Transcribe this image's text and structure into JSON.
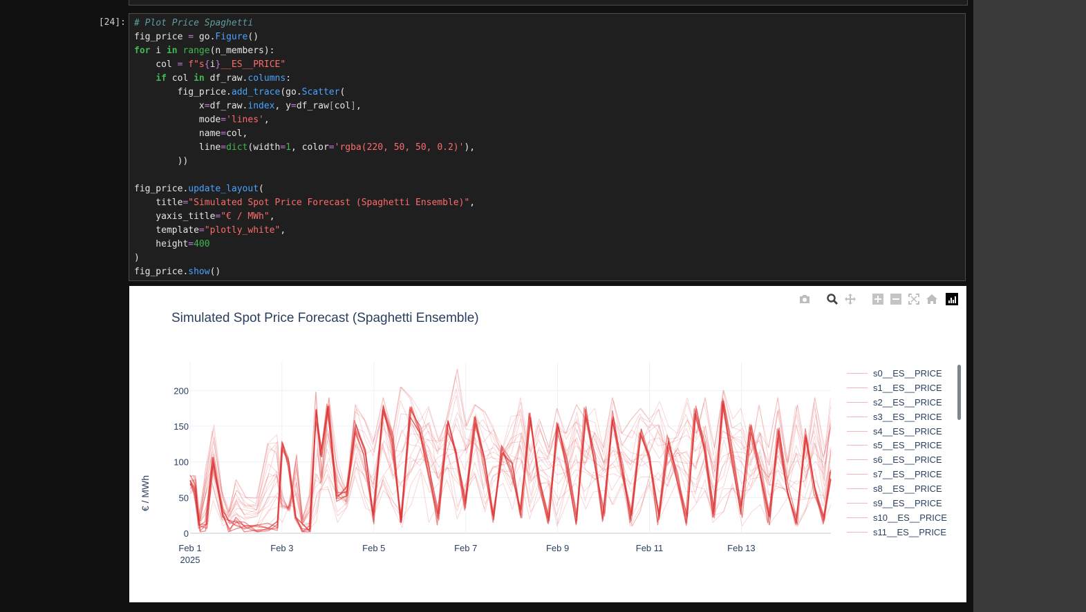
{
  "cell": {
    "prompt": "[24]:",
    "code_lines": [
      [
        [
          "# Plot Price Spaghetti",
          "comment"
        ]
      ],
      [
        [
          "fig_price ",
          ""
        ],
        [
          "=",
          "op"
        ],
        [
          " go.",
          ""
        ],
        [
          "Figure",
          "attr"
        ],
        [
          "()",
          ""
        ]
      ],
      [
        [
          "for",
          "kw"
        ],
        [
          " i ",
          ""
        ],
        [
          "in",
          "kw"
        ],
        [
          " ",
          ""
        ],
        [
          "range",
          "bi"
        ],
        [
          "(n_members):",
          ""
        ]
      ],
      [
        [
          "    col ",
          ""
        ],
        [
          "=",
          "op"
        ],
        [
          " ",
          ""
        ],
        [
          "f\"s",
          "str"
        ],
        [
          "{",
          "op"
        ],
        [
          "i",
          ""
        ],
        [
          "}",
          "op"
        ],
        [
          "__ES__PRICE\"",
          "str"
        ]
      ],
      [
        [
          "    ",
          ""
        ],
        [
          "if",
          "kw"
        ],
        [
          " col ",
          ""
        ],
        [
          "in",
          "kw"
        ],
        [
          " df_raw.",
          ""
        ],
        [
          "columns",
          "attr"
        ],
        [
          ":",
          ""
        ]
      ],
      [
        [
          "        fig_price.",
          ""
        ],
        [
          "add_trace",
          "attr"
        ],
        [
          "(go.",
          ""
        ],
        [
          "Scatter",
          "attr"
        ],
        [
          "(",
          ""
        ]
      ],
      [
        [
          "            x",
          ""
        ],
        [
          "=",
          "op"
        ],
        [
          "df_raw.",
          ""
        ],
        [
          "index",
          "attr"
        ],
        [
          ", y",
          ""
        ],
        [
          "=",
          "op"
        ],
        [
          "df_raw",
          ""
        ],
        [
          "[",
          "brk"
        ],
        [
          "col",
          ""
        ],
        [
          "]",
          "brk"
        ],
        [
          ",",
          ""
        ]
      ],
      [
        [
          "            mode",
          ""
        ],
        [
          "=",
          "op"
        ],
        [
          "'lines'",
          "str"
        ],
        [
          ",",
          ""
        ]
      ],
      [
        [
          "            name",
          ""
        ],
        [
          "=",
          "op"
        ],
        [
          "col,",
          ""
        ]
      ],
      [
        [
          "            line",
          ""
        ],
        [
          "=",
          "op"
        ],
        [
          "dict",
          "bi"
        ],
        [
          "(width",
          ""
        ],
        [
          "=",
          "op"
        ],
        [
          "1",
          "num"
        ],
        [
          ", color",
          ""
        ],
        [
          "=",
          "op"
        ],
        [
          "'rgba(220, 50, 50, 0.2)'",
          "str"
        ],
        [
          "),",
          ""
        ]
      ],
      [
        [
          "        ))",
          ""
        ]
      ],
      [],
      [
        [
          "fig_price.",
          ""
        ],
        [
          "update_layout",
          "attr"
        ],
        [
          "(",
          ""
        ]
      ],
      [
        [
          "    title",
          ""
        ],
        [
          "=",
          "op"
        ],
        [
          "\"Simulated Spot Price Forecast (Spaghetti Ensemble)\"",
          "str"
        ],
        [
          ",",
          ""
        ]
      ],
      [
        [
          "    yaxis_title",
          ""
        ],
        [
          "=",
          "op"
        ],
        [
          "\"€ / MWh\"",
          "str"
        ],
        [
          ",",
          ""
        ]
      ],
      [
        [
          "    template",
          ""
        ],
        [
          "=",
          "op"
        ],
        [
          "\"plotly_white\"",
          "str"
        ],
        [
          ",",
          ""
        ]
      ],
      [
        [
          "    height",
          ""
        ],
        [
          "=",
          "op"
        ],
        [
          "400",
          "num"
        ]
      ],
      [
        [
          ")",
          ""
        ]
      ],
      [
        [
          "fig_price.",
          ""
        ],
        [
          "show",
          "attr"
        ],
        [
          "()",
          ""
        ]
      ]
    ]
  },
  "modebar": {
    "icons": [
      "camera-icon",
      "zoom-icon",
      "pan-icon",
      "zoom-in-icon",
      "zoom-out-icon",
      "autoscale-icon",
      "reset-axes-icon",
      "plotly-logo-icon"
    ]
  },
  "chart_data": {
    "type": "line",
    "title": "Simulated Spot Price Forecast (Spaghetti Ensemble)",
    "xlabel": "",
    "ylabel": "€ / MWh",
    "x_ticks": [
      "Feb 1\n2025",
      "Feb 3",
      "Feb 5",
      "Feb 7",
      "Feb 9",
      "Feb 11",
      "Feb 13"
    ],
    "x_tick_days": [
      1,
      3,
      5,
      7,
      9,
      11,
      13
    ],
    "x_range_days": [
      1.0,
      14.95
    ],
    "y_ticks": [
      0,
      50,
      100,
      150,
      200
    ],
    "ylim": [
      0,
      240
    ],
    "grid": true,
    "legend_position": "right",
    "line_color": "rgba(220, 50, 50, 0.2)",
    "legend": [
      "s0__ES__PRICE",
      "s1__ES__PRICE",
      "s2__ES__PRICE",
      "s3__ES__PRICE",
      "s4__ES__PRICE",
      "s5__ES__PRICE",
      "s6__ES__PRICE",
      "s7__ES__PRICE",
      "s8__ES__PRICE",
      "s9__ES__PRICE",
      "s10__ES__PRICE",
      "s11__ES__PRICE"
    ],
    "envelope_days": [
      1.0,
      1.1,
      1.2,
      1.35,
      1.5,
      1.7,
      1.85,
      2.0,
      2.2,
      2.45,
      2.7,
      2.9,
      3.0,
      3.15,
      3.3,
      3.45,
      3.6,
      3.75,
      3.85,
      4.0,
      4.2,
      4.4,
      4.6,
      4.8,
      5.0,
      5.2,
      5.4,
      5.6,
      5.8,
      6.0,
      6.2,
      6.4,
      6.6,
      6.8,
      7.0,
      7.2,
      7.4,
      7.6,
      7.8,
      8.0,
      8.2,
      8.4,
      8.6,
      8.8,
      9.0,
      9.2,
      9.4,
      9.6,
      9.8,
      10.0,
      10.2,
      10.4,
      10.6,
      10.8,
      11.0,
      11.2,
      11.4,
      11.6,
      11.8,
      12.0,
      12.2,
      12.4,
      12.6,
      12.8,
      13.0,
      13.2,
      13.4,
      13.6,
      13.8,
      14.0,
      14.2,
      14.4,
      14.6,
      14.8,
      14.95
    ],
    "envelope_low": [
      55,
      60,
      10,
      5,
      40,
      8,
      15,
      10,
      5,
      3,
      5,
      8,
      15,
      40,
      35,
      10,
      5,
      3,
      60,
      50,
      15,
      30,
      60,
      35,
      10,
      60,
      40,
      8,
      40,
      70,
      15,
      40,
      70,
      20,
      50,
      80,
      30,
      60,
      70,
      30,
      70,
      20,
      50,
      70,
      10,
      40,
      70,
      10,
      30,
      60,
      40,
      70,
      10,
      30,
      60,
      20,
      30,
      70,
      10,
      40,
      60,
      15,
      30,
      60,
      10,
      30,
      40,
      10,
      30,
      50,
      10,
      30,
      50,
      10,
      40
    ],
    "envelope_high": [
      80,
      82,
      20,
      95,
      152,
      60,
      30,
      75,
      50,
      50,
      125,
      140,
      60,
      30,
      110,
      20,
      55,
      198,
      80,
      190,
      100,
      60,
      180,
      160,
      130,
      190,
      140,
      205,
      190,
      170,
      195,
      140,
      160,
      230,
      150,
      180,
      170,
      150,
      120,
      170,
      190,
      130,
      160,
      120,
      175,
      140,
      180,
      160,
      175,
      120,
      190,
      140,
      160,
      175,
      160,
      185,
      150,
      145,
      190,
      140,
      190,
      120,
      200,
      160,
      175,
      130,
      180,
      120,
      190,
      100,
      180,
      110,
      190,
      120,
      195
    ],
    "median": [
      75,
      62,
      8,
      10,
      100,
      30,
      10,
      15,
      8,
      4,
      8,
      12,
      120,
      100,
      20,
      5,
      4,
      165,
      110,
      175,
      50,
      60,
      150,
      110,
      20,
      175,
      130,
      10,
      170,
      145,
      90,
      20,
      150,
      115,
      40,
      160,
      100,
      20,
      120,
      90,
      30,
      160,
      70,
      20,
      150,
      100,
      20,
      170,
      100,
      20,
      165,
      90,
      20,
      140,
      110,
      20,
      130,
      80,
      20,
      170,
      120,
      30,
      180,
      110,
      30,
      150,
      90,
      20,
      140,
      60,
      20,
      140,
      60,
      20,
      80
    ],
    "n_series": 24
  }
}
